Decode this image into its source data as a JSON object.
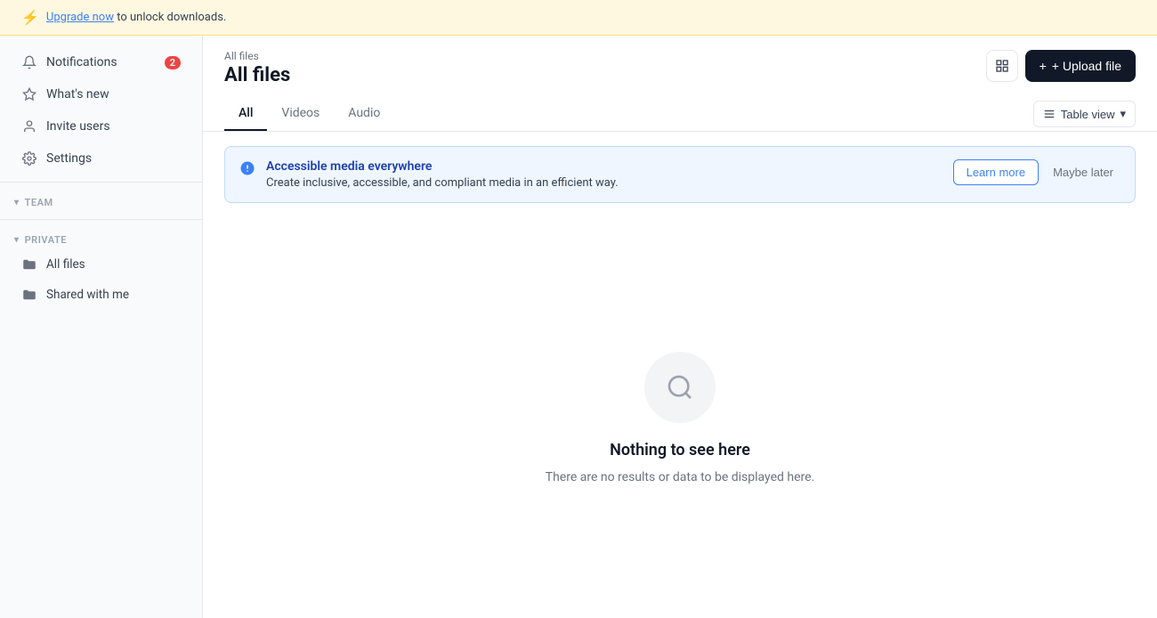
{
  "banner": {
    "text_prefix": "",
    "link_text": "Upgrade now",
    "text_suffix": " to unlock downloads.",
    "lightning": "⚡"
  },
  "sidebar": {
    "items": [
      {
        "id": "notifications",
        "label": "Notifications",
        "icon": "🔔",
        "badge": "2"
      },
      {
        "id": "whats-new",
        "label": "What's new",
        "icon": "✨",
        "badge": null
      },
      {
        "id": "invite-users",
        "label": "Invite users",
        "icon": "👤",
        "badge": null
      },
      {
        "id": "settings",
        "label": "Settings",
        "icon": "⚙️",
        "badge": null
      }
    ],
    "sections": [
      {
        "label": "TEAM",
        "chevron": "▾",
        "items": []
      },
      {
        "label": "PRIVATE",
        "chevron": "▾",
        "items": [
          {
            "id": "all-files",
            "label": "All files"
          },
          {
            "id": "shared-with-me",
            "label": "Shared with me"
          }
        ]
      }
    ]
  },
  "header": {
    "breadcrumb": "All files",
    "title": "All files",
    "upload_button": "+ Upload file"
  },
  "tabs": {
    "items": [
      {
        "id": "all",
        "label": "All",
        "active": true
      },
      {
        "id": "videos",
        "label": "Videos",
        "active": false
      },
      {
        "id": "audio",
        "label": "Audio",
        "active": false
      }
    ],
    "view_button": "Table view",
    "view_chevron": "▾"
  },
  "notification_banner": {
    "title": "Accessible media everywhere",
    "desc": "Create inclusive, accessible, and compliant media in an efficient way.",
    "learn_more": "Learn more",
    "maybe_later": "Maybe later"
  },
  "empty_state": {
    "title": "Nothing to see here",
    "desc": "There are no results or data to be displayed here."
  },
  "icons": {
    "grid": "⊞",
    "lightning": "⚡",
    "info": "ℹ"
  }
}
